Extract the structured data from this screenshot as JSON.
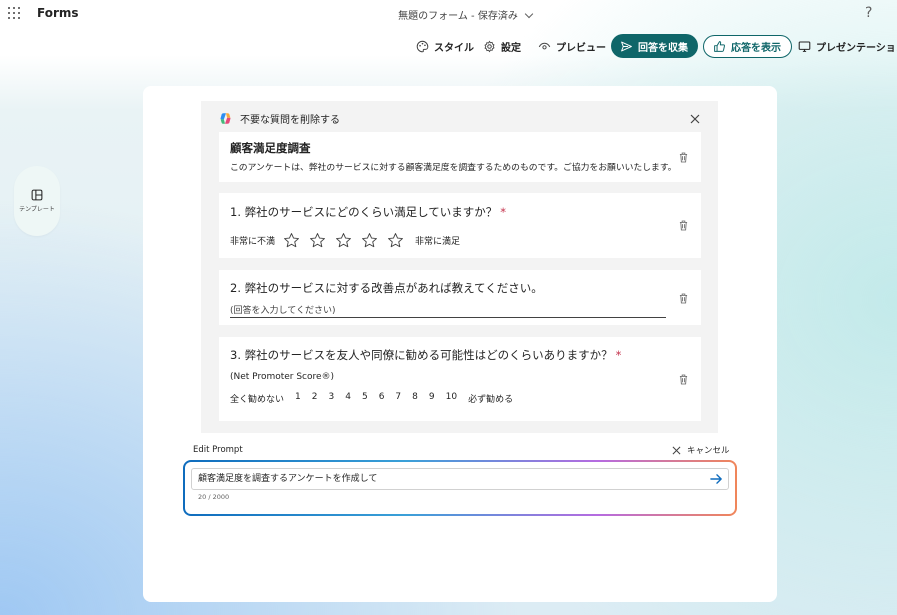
{
  "app": {
    "name": "Forms",
    "doc_title": "無題のフォーム - 保存済み",
    "help": "?"
  },
  "toolbar": {
    "style": "スタイル",
    "settings": "設定",
    "preview": "プレビュー",
    "collect": "回答を収集",
    "responses": "応答を表示",
    "presentation": "プレゼンテーション"
  },
  "sidebar": {
    "template_label": "テンプレート"
  },
  "panel": {
    "header": "不要な質問を削除する"
  },
  "form": {
    "title": "顧客満足度調査",
    "description": "このアンケートは、弊社のサービスに対する顧客満足度を調査するためのものです。ご協力をお願いいたします。"
  },
  "questions": [
    {
      "title": "1. 弊社のサービスにどのくらい満足していますか？",
      "required": "*",
      "low_label": "非常に不満",
      "high_label": "非常に満足",
      "star_count": 5
    },
    {
      "title": "2. 弊社のサービスに対する改善点があれば教えてください。",
      "placeholder": "(回答を入力してください)"
    },
    {
      "title": "3. 弊社のサービスを友人や同僚に勧める可能性はどのくらいありますか？",
      "required": "*",
      "subtitle": "(Net Promoter Score®)",
      "low_label": "全く勧めない",
      "scale": [
        "1",
        "2",
        "3",
        "4",
        "5",
        "6",
        "7",
        "8",
        "9",
        "10"
      ],
      "high_label": "必ず勧める"
    }
  ],
  "prompt": {
    "label": "Edit Prompt",
    "cancel": "キャンセル",
    "value": "顧客満足度を調査するアンケートを作成して",
    "counter": "20 / 2000"
  },
  "colors": {
    "accent": "#0f6669",
    "required": "#c4314b"
  }
}
